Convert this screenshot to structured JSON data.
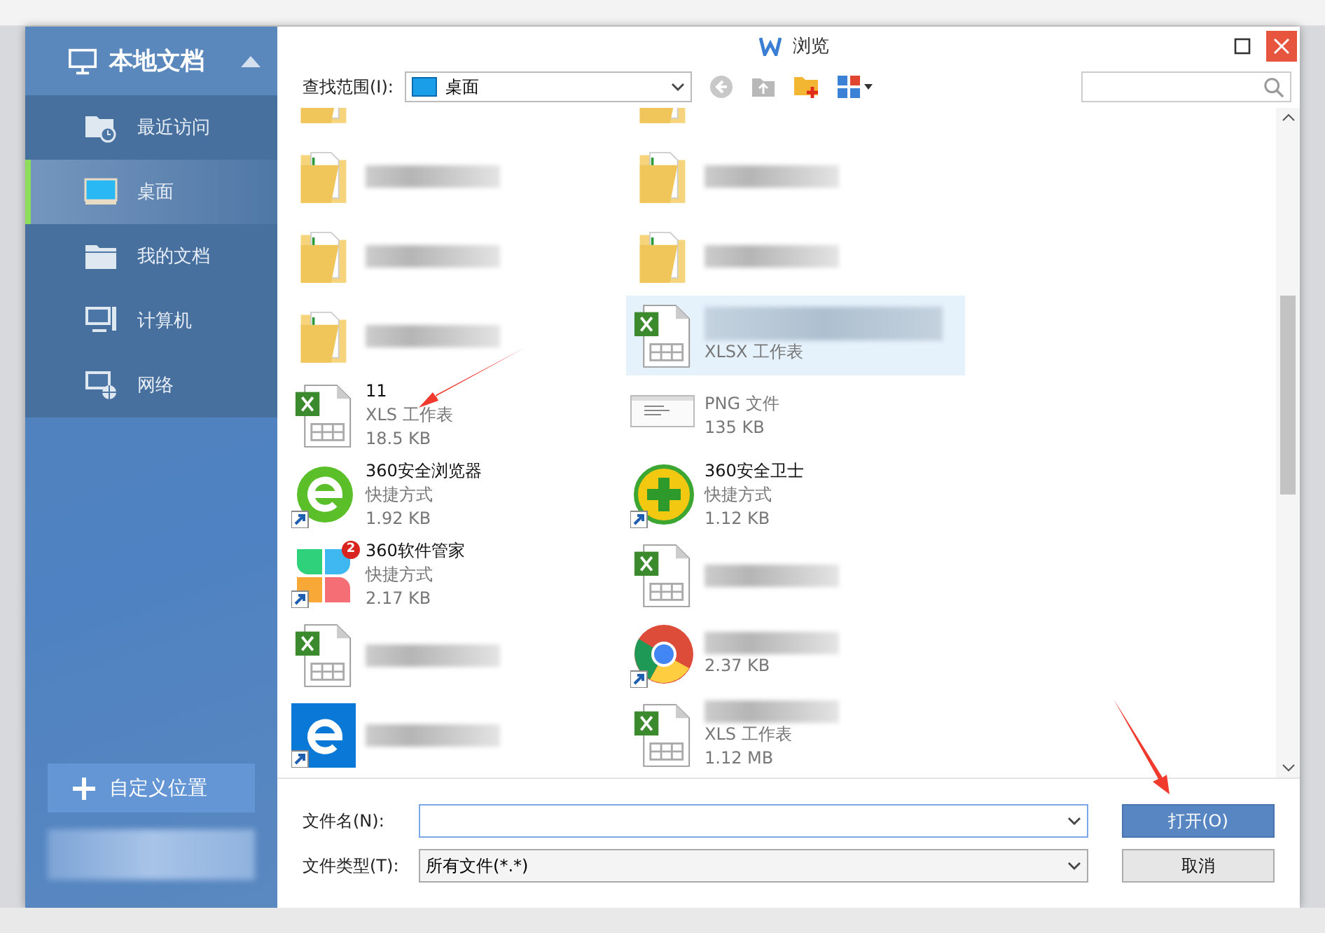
{
  "window": {
    "title": "浏览"
  },
  "sidebar": {
    "title": "本地文档",
    "expanded": true,
    "items": [
      {
        "label": "最近访问",
        "kind": "recent",
        "selected": false
      },
      {
        "label": "桌面",
        "kind": "desktop",
        "selected": true
      },
      {
        "label": "我的文档",
        "kind": "documents",
        "selected": false
      },
      {
        "label": "计算机",
        "kind": "computer",
        "selected": false
      },
      {
        "label": "网络",
        "kind": "network",
        "selected": false
      }
    ],
    "custom_button": "自定义位置"
  },
  "toolbar": {
    "look_in_label": "查找范围(I):",
    "look_in_value": "桌面"
  },
  "files": [
    {
      "kind": "folder",
      "blurred": false,
      "selected": false,
      "pointed": false
    },
    {
      "kind": "folder",
      "blurred": false,
      "selected": false,
      "pointed": false
    },
    {
      "kind": "folder",
      "blurred": true,
      "selected": false,
      "pointed": false
    },
    {
      "kind": "folder",
      "blurred": true,
      "selected": false,
      "pointed": false
    },
    {
      "kind": "folder",
      "blurred": true,
      "selected": false,
      "pointed": false
    },
    {
      "kind": "folder",
      "blurred": true,
      "selected": false,
      "pointed": false
    },
    {
      "kind": "folder",
      "blurred": true,
      "selected": false,
      "pointed": false
    },
    {
      "kind": "excel",
      "blurred": true,
      "type": "XLSX 工作表",
      "selected": true,
      "pointed": false
    },
    {
      "kind": "excel",
      "blurred": false,
      "name": "11",
      "type": "XLS 工作表",
      "size": "18.5 KB",
      "selected": false,
      "pointed": true
    },
    {
      "kind": "image",
      "blurred": false,
      "type": "PNG 文件",
      "size": "135 KB",
      "selected": false,
      "pointed": false
    },
    {
      "kind": "browser",
      "blurred": false,
      "name": "360安全浏览器",
      "type": "快捷方式",
      "size": "1.92 KB",
      "selected": false,
      "pointed": false
    },
    {
      "kind": "guard",
      "blurred": false,
      "name": "360安全卫士",
      "type": "快捷方式",
      "size": "1.12 KB",
      "selected": false,
      "pointed": false
    },
    {
      "kind": "manager",
      "badge": "2",
      "blurred": false,
      "name": "360软件管家",
      "type": "快捷方式",
      "size": "2.17 KB",
      "selected": false,
      "pointed": false
    },
    {
      "kind": "excel",
      "blurred": true,
      "selected": false,
      "pointed": false
    },
    {
      "kind": "excel",
      "blurred": true,
      "selected": false,
      "pointed": false
    },
    {
      "kind": "chrome",
      "blurred": true,
      "size": "2.37 KB",
      "selected": false,
      "pointed": false
    },
    {
      "kind": "edge",
      "blurred": true,
      "selected": false,
      "pointed": false
    },
    {
      "kind": "excel",
      "blurred": true,
      "type": "XLS 工作表",
      "size": "1.12 MB",
      "selected": false,
      "pointed": false
    }
  ],
  "filename": {
    "label": "文件名(N):"
  },
  "filetype": {
    "label": "文件类型(T):",
    "value": "所有文件(*.*)"
  },
  "buttons": [
    {
      "label": "打开(O)",
      "kind": "primary",
      "pointed": true
    },
    {
      "label": "取消",
      "kind": "secondary"
    }
  ]
}
